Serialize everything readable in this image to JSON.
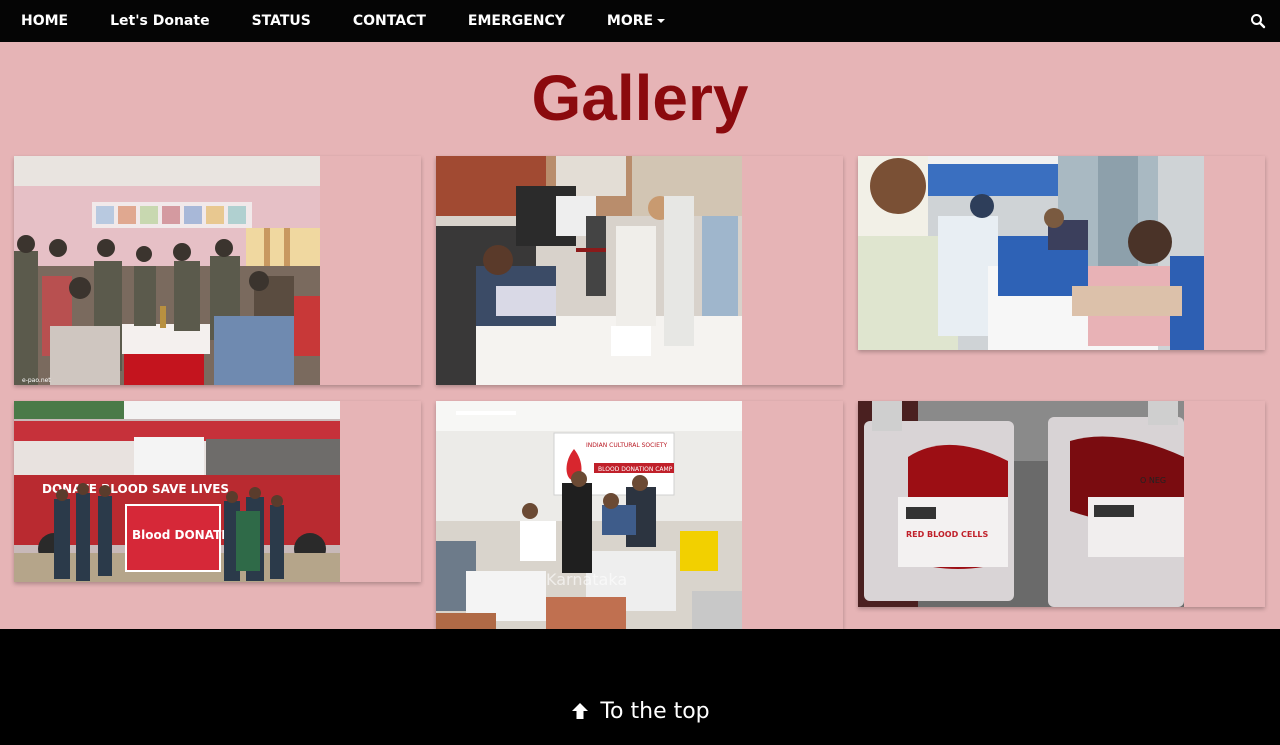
{
  "navbar": {
    "items": [
      {
        "label": "HOME"
      },
      {
        "label": "Let's Donate"
      },
      {
        "label": "STATUS"
      },
      {
        "label": "CONTACT"
      },
      {
        "label": "EMERGENCY"
      },
      {
        "label": "MORE"
      }
    ],
    "search_icon": "search-icon"
  },
  "page": {
    "title": "Gallery"
  },
  "gallery": {
    "photos": [
      {
        "caption_mark": "e-pao.net"
      },
      {
        "caption_mark": ""
      },
      {
        "caption_mark": ""
      },
      {
        "banner_text": "DONATE BLOOD SAVE LIVES",
        "sign_text": "Blood DONATION"
      },
      {
        "banner_title": "INDIAN CULTURAL SOCIETY",
        "banner_sub": "BLOOD DONATION CAMP",
        "watermark": "Karnataka"
      },
      {
        "label_a": "RED BLOOD CELLS",
        "label_b": "O NEG"
      }
    ]
  },
  "footer": {
    "to_top_label": "To the top"
  },
  "colors": {
    "navbar_bg": "#050505",
    "page_bg": "#e6b4b6",
    "title_color": "#8b0a0e",
    "footer_bg": "#000000"
  }
}
